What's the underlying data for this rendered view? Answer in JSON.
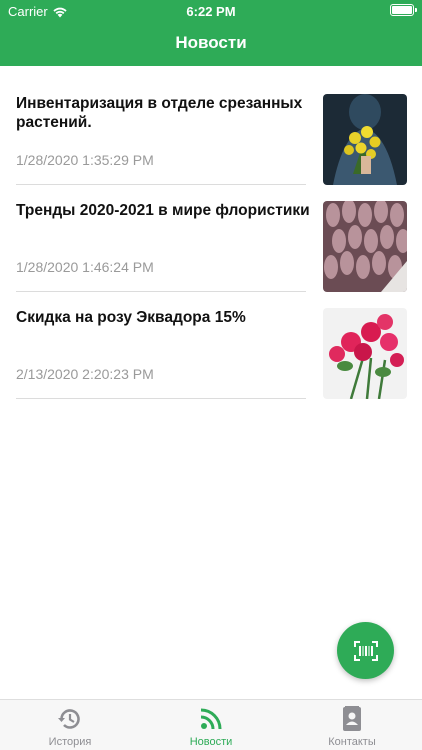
{
  "status_bar": {
    "carrier": "Carrier",
    "time": "6:22 PM"
  },
  "nav": {
    "title": "Новости"
  },
  "news": [
    {
      "title": "Инвентаризация в отделе срезанных растений.",
      "date": "1/28/2020 1:35:29 PM"
    },
    {
      "title": "Тренды 2020-2021 в мире флористики",
      "date": "1/28/2020 1:46:24 PM"
    },
    {
      "title": "Скидка на розу Эквадора 15%",
      "date": "2/13/2020 2:20:23 PM"
    }
  ],
  "tabs": [
    {
      "label": "История",
      "icon": "history-icon"
    },
    {
      "label": "Новости",
      "icon": "rss-feed-icon"
    },
    {
      "label": "Контакты",
      "icon": "contacts-icon"
    }
  ],
  "colors": {
    "accent": "#2eab57",
    "date_gray": "#9a9a9a",
    "tab_inactive": "#8e8e93"
  }
}
